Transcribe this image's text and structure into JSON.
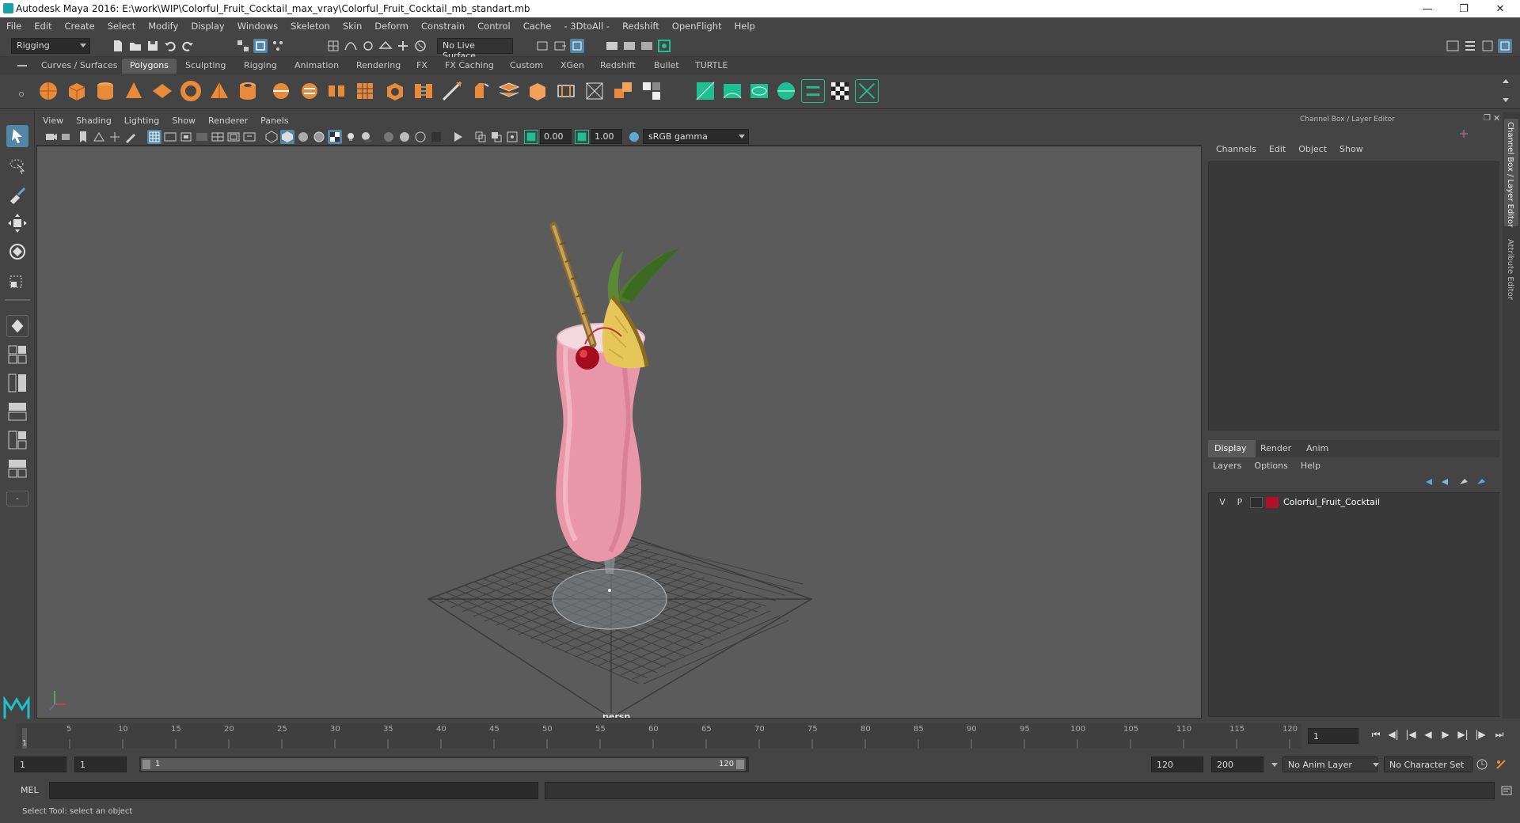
{
  "window": {
    "title": "Autodesk Maya 2016: E:\\work\\WIP\\Colorful_Fruit_Cocktail_max_vray\\Colorful_Fruit_Cocktail_mb_standart.mb",
    "minimize_icon": "minimize-icon",
    "restore_icon": "restore-icon",
    "close_icon": "close-icon"
  },
  "menubar": [
    "File",
    "Edit",
    "Create",
    "Select",
    "Modify",
    "Display",
    "Windows",
    "Skeleton",
    "Skin",
    "Deform",
    "Constrain",
    "Control",
    "Cache",
    "- 3DtoAll -",
    "Redshift",
    "OpenFlight",
    "Help"
  ],
  "statusline": {
    "menuset": "Rigging",
    "live_surface": "No Live Surface"
  },
  "shelf_tabs": [
    "Curves / Surfaces",
    "Polygons",
    "Sculpting",
    "Rigging",
    "Animation",
    "Rendering",
    "FX",
    "FX Caching",
    "Custom",
    "XGen",
    "Redshift",
    "Bullet",
    "TURTLE"
  ],
  "shelf_active_tab": "Polygons",
  "viewport": {
    "menus": [
      "View",
      "Shading",
      "Lighting",
      "Show",
      "Renderer",
      "Panels"
    ],
    "field_a": "0.00",
    "field_b": "1.00",
    "color_space": "sRGB gamma",
    "camera_label": "persp"
  },
  "channel_box": {
    "title": "Channel Box / Layer Editor",
    "menus": [
      "Channels",
      "Edit",
      "Object",
      "Show"
    ]
  },
  "layer_editor": {
    "tabs": [
      "Display",
      "Render",
      "Anim"
    ],
    "active_tab": "Display",
    "menus": [
      "Layers",
      "Options",
      "Help"
    ],
    "layers": [
      {
        "v": "V",
        "p": "P",
        "color": "#b0102a",
        "name": "Colorful_Fruit_Cocktail"
      }
    ]
  },
  "side_tabs": [
    "Channel Box / Layer Editor",
    "Attribute Editor"
  ],
  "timeline": {
    "ticks": [
      "1",
      "5",
      "10",
      "15",
      "20",
      "25",
      "30",
      "35",
      "40",
      "45",
      "50",
      "55",
      "60",
      "65",
      "70",
      "75",
      "80",
      "85",
      "90",
      "95",
      "100",
      "105",
      "110",
      "115",
      "120"
    ],
    "current_frame": "1"
  },
  "range": {
    "start": "1",
    "playback_start": "1",
    "slider_start": "1",
    "slider_end": "120",
    "playback_end": "120",
    "end": "200",
    "anim_layer": "No Anim Layer",
    "character_set": "No Character Set"
  },
  "cmdline": {
    "label": "MEL"
  },
  "helpline": {
    "text": "Select Tool: select an object"
  },
  "colors": {
    "bg": "#444444",
    "viewport_bg": "#5b5b5b",
    "accent": "#5285a6",
    "layer_color": "#b0102a"
  }
}
